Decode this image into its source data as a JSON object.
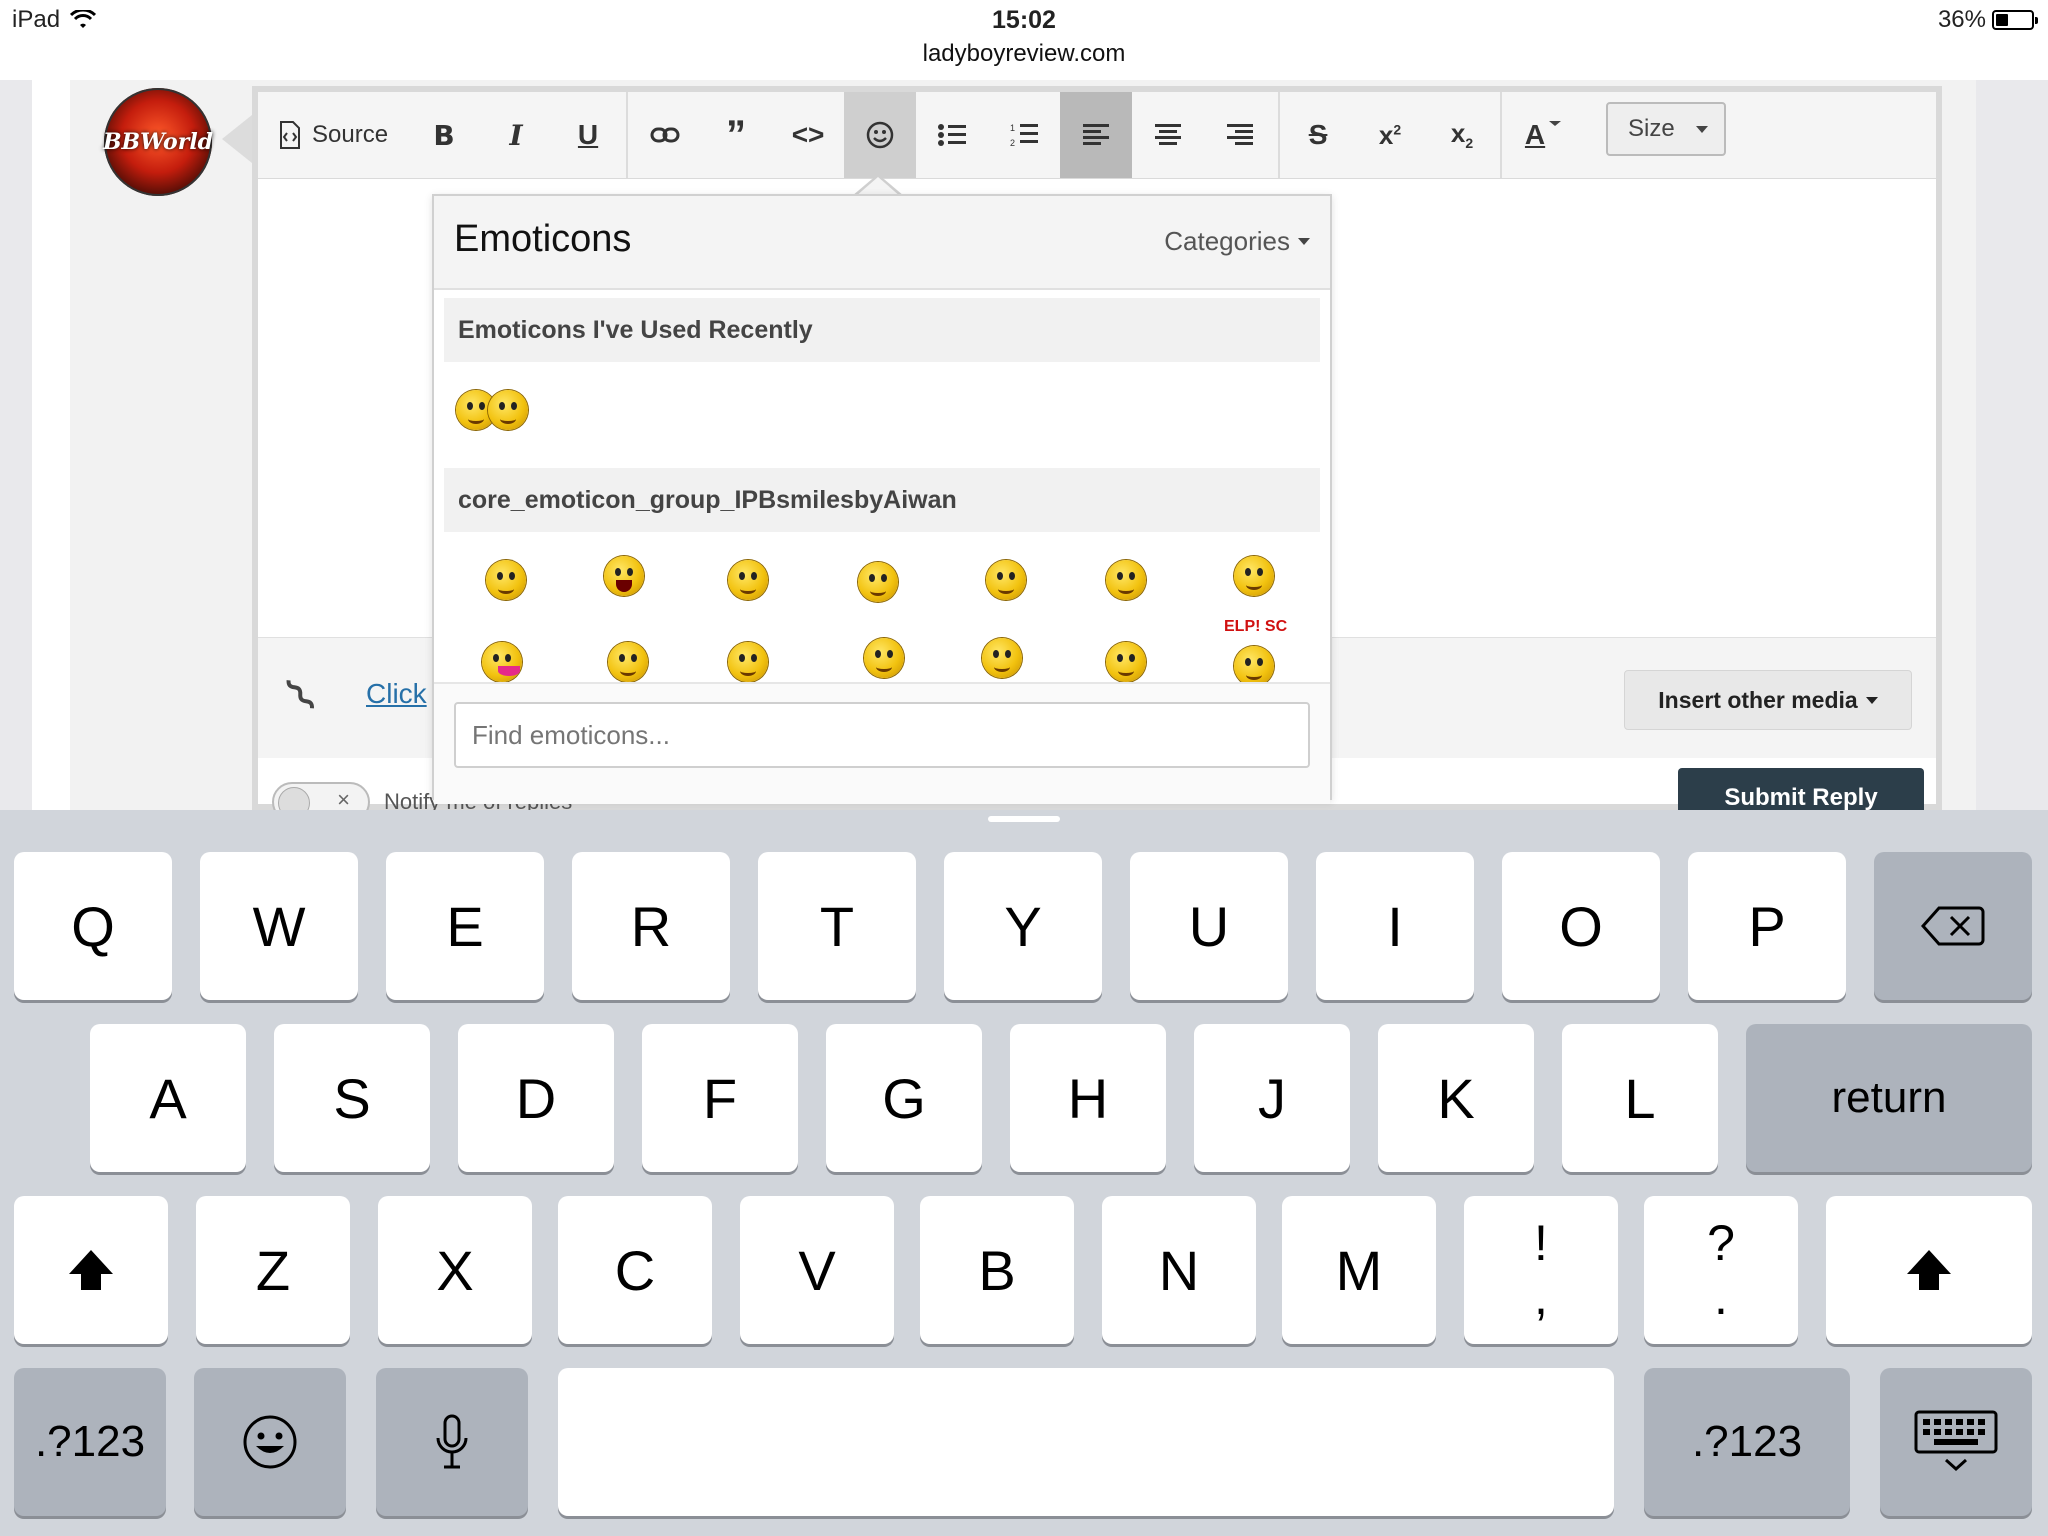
{
  "status_bar": {
    "device": "iPad",
    "time": "15:02",
    "url": "ladyboyreview.com",
    "battery": "36%",
    "battery_fill": 0.36
  },
  "avatar": {
    "text": "BBWorld"
  },
  "toolbar": {
    "source_label": "Source",
    "size_label": "Size",
    "icons": [
      "source-icon",
      "bold-icon",
      "italic-icon",
      "underline-icon",
      "link-icon",
      "quote-icon",
      "code-icon",
      "emoticon-icon",
      "bullet-list-icon",
      "numbered-list-icon",
      "align-left-icon",
      "align-center-icon",
      "align-right-icon",
      "strikethrough-icon",
      "superscript-icon",
      "subscript-icon",
      "text-color-icon"
    ]
  },
  "editor": {
    "attach_link": "Click",
    "insert_media_label": "Insert other media",
    "notify_label": "Notify me of replies",
    "submit_label": "Submit Reply"
  },
  "emoticons": {
    "title": "Emoticons",
    "categories_label": "Categories",
    "recent_heading": "Emoticons I've Used Recently",
    "group_heading": "core_emoticon_group_IPBsmilesbyAiwan",
    "search_placeholder": "Find emoticons...",
    "sign_text": "ELP! SC"
  },
  "keyboard": {
    "row1": [
      "Q",
      "W",
      "E",
      "R",
      "T",
      "Y",
      "U",
      "I",
      "O",
      "P"
    ],
    "row2": [
      "A",
      "S",
      "D",
      "F",
      "G",
      "H",
      "J",
      "K",
      "L"
    ],
    "row3": [
      "Z",
      "X",
      "C",
      "V",
      "B",
      "N",
      "M"
    ],
    "punct1_top": "!",
    "punct1_bottom": ",",
    "punct2_top": "?",
    "punct2_bottom": ".",
    "return_label": "return",
    "numbers_label": ".?123"
  }
}
